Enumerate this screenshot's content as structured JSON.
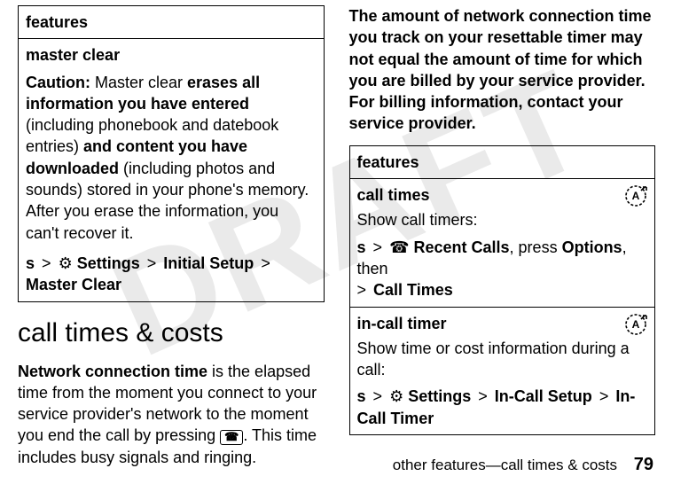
{
  "watermark": "DRAFT",
  "left": {
    "features_header": "features",
    "master_clear_title": "master clear",
    "mc_caution_label": "Caution:",
    "mc_part1": " Master clear ",
    "mc_bold1": "erases all information you have entered",
    "mc_part2": " (including phonebook and datebook entries) ",
    "mc_bold2": "and content you have downloaded",
    "mc_part3": " (including photos and sounds) stored in your phone's memory. After you erase the information, you can't recover it.",
    "mc_nav_settings": "Settings",
    "mc_nav_initial": "Initial Setup",
    "mc_nav_master": "Master Clear",
    "section_heading": "call times & costs",
    "para1_bold": "Network connection time",
    "para1_rest": " is the elapsed time from the moment you connect to your service provider's network to the moment you end the call by pressing ",
    "para1_tail": ". This time includes busy signals and ringing.",
    "endkey_glyph": "☎"
  },
  "right": {
    "top_para": "The amount of network connection time you track on your resettable timer may not equal the amount of time for which you are billed by your service provider. For billing information, contact your service provider.",
    "features_header": "features",
    "row1_title": "call times",
    "row1_desc": "Show call timers:",
    "row1_nav_recent": "Recent Calls",
    "row1_nav_press": ", press ",
    "row1_nav_options": "Options",
    "row1_nav_then": ", then",
    "row1_nav_call_times": "Call Times",
    "row2_title": "in-call timer",
    "row2_desc": "Show time or cost information during a call:",
    "row2_nav_settings": "Settings",
    "row2_nav_incall_setup": "In-Call Setup",
    "row2_nav_incall_timer": "In-Call Timer"
  },
  "glyphs": {
    "keydot": "s",
    "gt": ">",
    "tools": "⚙",
    "recent": "☎"
  },
  "footer": {
    "text": "other features—call times & costs",
    "page": "79"
  }
}
